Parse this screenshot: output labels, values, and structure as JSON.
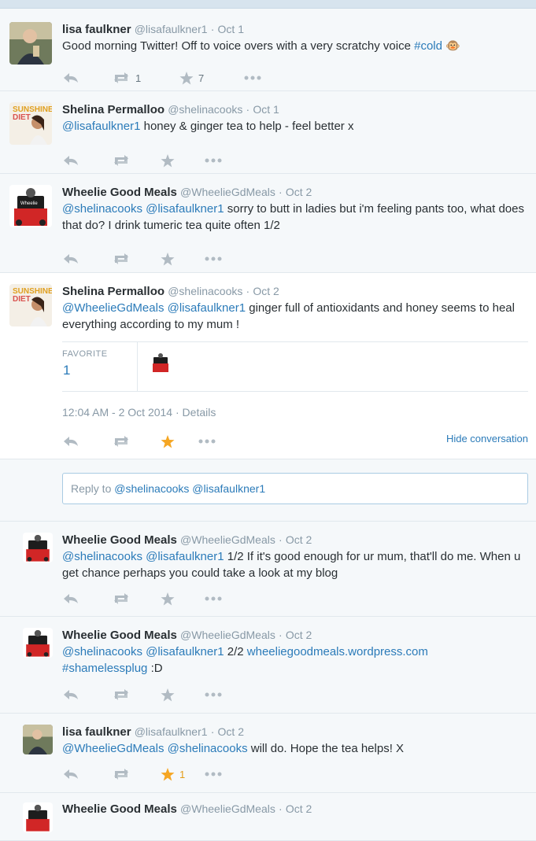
{
  "tweets": [
    {
      "name": "lisa faulkner",
      "handle": "@lisafaulkner1",
      "time": "Oct 1",
      "text_parts": [
        "Good morning Twitter! Off to voice overs with a very scratchy voice ",
        "#cold",
        " 🐵"
      ],
      "retweets": "1",
      "favorites": "7"
    },
    {
      "name": "Shelina Permalloo",
      "handle": "@shelinacooks",
      "time": "Oct 1",
      "text_parts": [
        "@lisafaulkner1",
        " honey & ginger tea to help - feel better x"
      ]
    },
    {
      "name": "Wheelie Good Meals",
      "handle": "@WheelieGdMeals",
      "time": "Oct 2",
      "text_parts": [
        "@shelinacooks",
        " ",
        "@lisafaulkner1",
        " sorry to butt in ladies but i'm feeling pants too, what does that do? I drink tumeric tea quite often 1/2"
      ]
    },
    {
      "name": "Shelina Permalloo",
      "handle": "@shelinacooks",
      "time": "Oct 2",
      "text_parts": [
        "@WheelieGdMeals",
        " ",
        "@lisafaulkner1",
        " ginger full of antioxidants and honey seems to heal everything according to my mum !"
      ],
      "favorite_label": "FAVORITE",
      "favorite_count": "1",
      "timestamp": "12:04 AM - 2 Oct 2014",
      "details": "Details",
      "hide_conversation": "Hide conversation"
    },
    {
      "name": "Wheelie Good Meals",
      "handle": "@WheelieGdMeals",
      "time": "Oct 2",
      "text_parts": [
        "@shelinacooks",
        " ",
        "@lisafaulkner1",
        " 1/2 If it's good enough for ur mum, that'll do me. When u get chance perhaps you could take a look at my blog"
      ]
    },
    {
      "name": "Wheelie Good Meals",
      "handle": "@WheelieGdMeals",
      "time": "Oct 2",
      "text_parts": [
        "@shelinacooks",
        " ",
        "@lisafaulkner1",
        " 2/2 ",
        "wheeliegoodmeals.wordpress.com",
        " ",
        "#shamelessplug",
        " :D"
      ]
    },
    {
      "name": "lisa faulkner",
      "handle": "@lisafaulkner1",
      "time": "Oct 2",
      "text_parts": [
        "@WheelieGdMeals",
        " ",
        "@shelinacooks",
        " will do. Hope the tea helps! X"
      ],
      "favorites": "1"
    },
    {
      "name": "Wheelie Good Meals",
      "handle": "@WheelieGdMeals",
      "time": "Oct 2"
    }
  ],
  "reply": {
    "prefix": "Reply to ",
    "mentions": "@shelinacooks @lisafaulkner1"
  },
  "colors": {
    "link": "#2b7bb9",
    "star_active": "#f5a623",
    "icon": "#b1bbc3"
  },
  "icons": [
    "reply-icon",
    "retweet-icon",
    "favorite-icon",
    "more-icon"
  ]
}
